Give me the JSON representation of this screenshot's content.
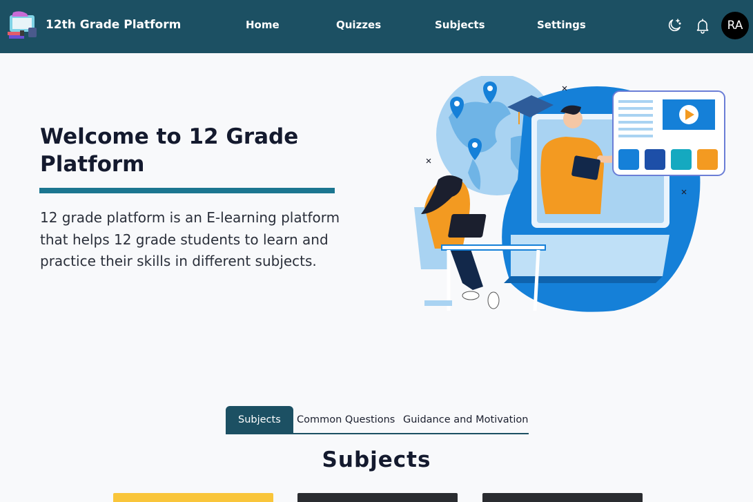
{
  "brand": {
    "title": "12th Grade Platform"
  },
  "nav": {
    "links": [
      {
        "label": "Home"
      },
      {
        "label": "Quizzes"
      },
      {
        "label": "Subjects"
      },
      {
        "label": "Settings"
      }
    ],
    "avatar_initials": "RA"
  },
  "hero": {
    "title": "Welcome to 12 Grade Platform",
    "description": "12 grade platform is an E-learning platform that helps 12 grade students to learn and practice their skills in different subjects."
  },
  "tabs": [
    {
      "label": "Subjects",
      "active": true
    },
    {
      "label": "Common Questions",
      "active": false
    },
    {
      "label": "Guidance and Motivation",
      "active": false
    }
  ],
  "section": {
    "title": "Subjects"
  },
  "colors": {
    "navbar": "#1c5063",
    "accent": "#1b7690",
    "illustration_blue": "#1580d8",
    "illustration_orange": "#f39a21"
  },
  "icons": {
    "theme_toggle": "moon-stars-icon",
    "notifications": "bell-icon"
  }
}
